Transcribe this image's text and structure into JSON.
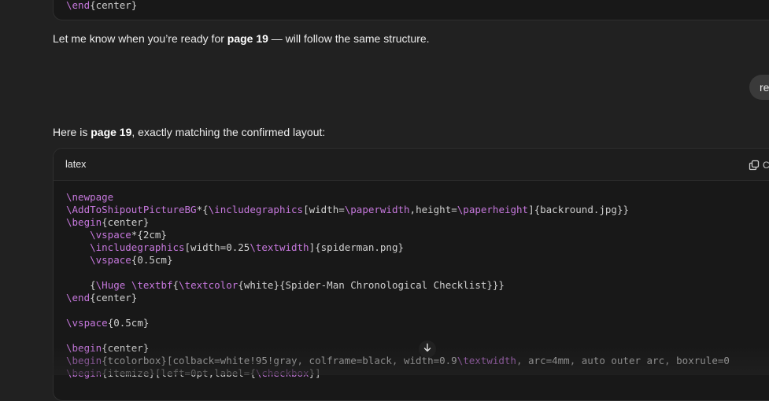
{
  "prev_code_tail": {
    "kw": "\\end",
    "arg": "{center}"
  },
  "messages": {
    "p1": {
      "before": "Let me know when you’re ready for ",
      "bold": "page 19",
      "after": " — will follow the same structure."
    },
    "user_bubble_text": "re",
    "p2": {
      "before": "Here is ",
      "bold": "page 19",
      "after": ", exactly matching the confirmed layout:"
    }
  },
  "code_block": {
    "language": "latex",
    "copy_label": "C",
    "lines": [
      [
        {
          "t": "\\newpage",
          "c": "kw"
        }
      ],
      [
        {
          "t": "\\AddToShipoutPictureBG",
          "c": "kw"
        },
        {
          "t": "*{",
          "c": "tx"
        },
        {
          "t": "\\includegraphics",
          "c": "kw"
        },
        {
          "t": "[width=",
          "c": "tx"
        },
        {
          "t": "\\paperwidth",
          "c": "kw"
        },
        {
          "t": ",height=",
          "c": "tx"
        },
        {
          "t": "\\paperheight",
          "c": "kw"
        },
        {
          "t": "]{backround.jpg}}",
          "c": "tx"
        }
      ],
      [
        {
          "t": "\\begin",
          "c": "kw"
        },
        {
          "t": "{center}",
          "c": "tx"
        }
      ],
      [
        {
          "t": "    ",
          "c": "tx"
        },
        {
          "t": "\\vspace",
          "c": "kw"
        },
        {
          "t": "*{2cm}",
          "c": "tx"
        }
      ],
      [
        {
          "t": "    ",
          "c": "tx"
        },
        {
          "t": "\\includegraphics",
          "c": "kw"
        },
        {
          "t": "[width=0.25",
          "c": "tx"
        },
        {
          "t": "\\textwidth",
          "c": "kw"
        },
        {
          "t": "]{spiderman.png}",
          "c": "tx"
        }
      ],
      [
        {
          "t": "    ",
          "c": "tx"
        },
        {
          "t": "\\vspace",
          "c": "kw"
        },
        {
          "t": "{0.5cm}",
          "c": "tx"
        }
      ],
      [],
      [
        {
          "t": "    {",
          "c": "tx"
        },
        {
          "t": "\\Huge",
          "c": "kw"
        },
        {
          "t": " ",
          "c": "tx"
        },
        {
          "t": "\\textbf",
          "c": "kw"
        },
        {
          "t": "{",
          "c": "tx"
        },
        {
          "t": "\\textcolor",
          "c": "kw"
        },
        {
          "t": "{white}{Spider-Man Chronological Checklist}}}",
          "c": "tx"
        }
      ],
      [
        {
          "t": "\\end",
          "c": "kw"
        },
        {
          "t": "{center}",
          "c": "tx"
        }
      ],
      [],
      [
        {
          "t": "\\vspace",
          "c": "kw"
        },
        {
          "t": "{0.5cm}",
          "c": "tx"
        }
      ],
      [],
      [
        {
          "t": "\\begin",
          "c": "kw"
        },
        {
          "t": "{center}",
          "c": "tx"
        }
      ],
      [
        {
          "t": "\\begin",
          "c": "kw"
        },
        {
          "t": "{tcolorbox}[colback=white!95!gray, colframe=black, width=0.9",
          "c": "tx"
        },
        {
          "t": "\\textwidth",
          "c": "kw"
        },
        {
          "t": ", arc=4mm, auto outer arc, boxrule=0",
          "c": "tx"
        }
      ],
      [
        {
          "t": "\\begin",
          "c": "kw"
        },
        {
          "t": "{itemize}[left=0pt,label=",
          "c": "tx"
        },
        {
          "t": "{",
          "c": "tx"
        },
        {
          "t": "\\checkbox",
          "c": "kw"
        },
        {
          "t": "}]",
          "c": "tx"
        }
      ]
    ]
  },
  "colors": {
    "background": "#212121",
    "code_background": "#181818",
    "keyword": "#c678dd",
    "code_text": "#cfcfcf"
  },
  "icons": {
    "copy": "copy-icon",
    "scroll": "arrow-down-icon"
  }
}
